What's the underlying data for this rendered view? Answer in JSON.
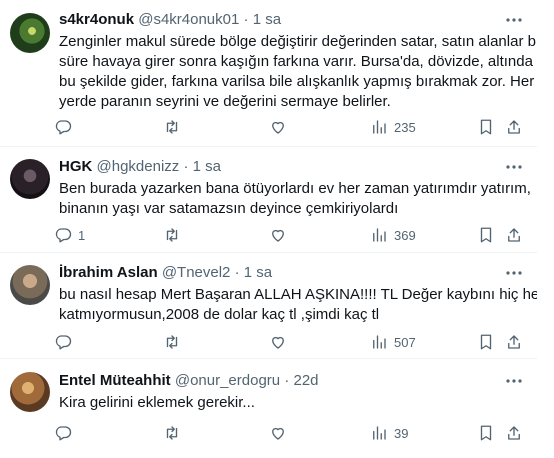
{
  "tweets": [
    {
      "name": "s4kr4onuk",
      "handle": "@s4kr4onuk01",
      "dot": "·",
      "time": "1 sa",
      "lines": [
        "Zenginler makul sürede bölge değiştirir değerinden satar, satın alanlar bir",
        "süre havaya girer sonra kaşığın farkına varır. Bursa'da, dövizde, altında hep",
        "bu şekilde gider, farkına varilsa bile alışkanlık yapmış bırakmak zor. Her",
        "yerde paranın seyrini ve değerini sermaye belirler."
      ],
      "replies": "",
      "views": "235"
    },
    {
      "name": "HGK",
      "handle": "@hgkdenizz",
      "dot": "·",
      "time": "1 sa",
      "lines": [
        "Ben burada yazarken bana ötüyorlardı ev her zaman yatırımdır yatırım,",
        "binanın yaşı var satamazsın deyince çemkiriyolardı"
      ],
      "replies": "1",
      "views": "369"
    },
    {
      "name": "İbrahim Aslan",
      "handle": "@Tnevel2",
      "dot": "·",
      "time": "1 sa",
      "lines": [
        "bu nasıl hesap Mert Başaran ALLAH AŞKINA!!!! TL Değer kaybını hiç hesaba",
        "katmıyormusun,2008 de dolar kaç tl ,şimdi kaç tl"
      ],
      "replies": "",
      "views": "507"
    },
    {
      "name": "Entel Müteahhit",
      "handle": "@onur_erdogru",
      "dot": "·",
      "time": "22d",
      "lines": [
        "Kira gelirini eklemek gerekir..."
      ],
      "replies": "",
      "views": "39"
    }
  ],
  "icons": {
    "more": "more-icon",
    "reply": "reply-icon",
    "retweet": "retweet-icon",
    "like": "like-icon",
    "views": "views-icon",
    "bookmark": "bookmark-icon",
    "share": "share-icon"
  },
  "colors": {
    "text": "#0f1419",
    "muted": "#536471",
    "border": "#eff3f4"
  }
}
